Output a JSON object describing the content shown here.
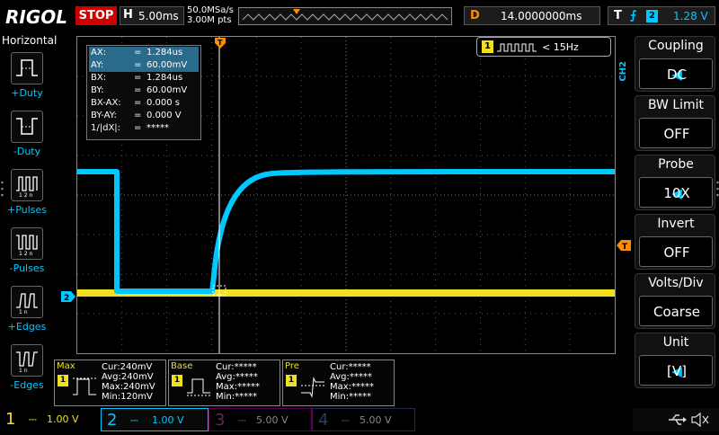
{
  "header": {
    "brand": "RIGOL",
    "run_state": "STOP",
    "timebase_key": "H",
    "timebase": "5.00ms",
    "sample_rate": "50.0MSa/s",
    "memory_depth": "3.00M pts",
    "delay_key": "D",
    "delay": "14.0000000ms",
    "trigger_key": "T",
    "trigger_source": "2",
    "trigger_level": "1.28 V"
  },
  "left_menu": {
    "title": "Horizontal",
    "items": [
      {
        "label": "+Duty"
      },
      {
        "label": "-Duty"
      },
      {
        "label": "+Pulses"
      },
      {
        "label": "-Pulses"
      },
      {
        "label": "+Edges"
      },
      {
        "label": "-Edges"
      }
    ]
  },
  "cursor": {
    "rows": [
      {
        "name": "AX:",
        "eq": "=",
        "value": "1.284us"
      },
      {
        "name": "AY:",
        "eq": "=",
        "value": "60.00mV"
      },
      {
        "name": "BX:",
        "eq": "=",
        "value": "1.284us"
      },
      {
        "name": "BY:",
        "eq": "=",
        "value": "60.00mV"
      },
      {
        "name": "BX-AX:",
        "eq": "=",
        "value": "0.000 s"
      },
      {
        "name": "BY-AY:",
        "eq": "=",
        "value": "0.000 V"
      },
      {
        "name": "1/|dX|:",
        "eq": "=",
        "value": "*****"
      }
    ]
  },
  "frequency": {
    "channel": "1",
    "value": "< 15Hz"
  },
  "side_label": "CH2",
  "right_menu": {
    "items": [
      {
        "title": "Coupling",
        "value": "DC"
      },
      {
        "title": "BW Limit",
        "value": "OFF"
      },
      {
        "title": "Probe",
        "value": "10X"
      },
      {
        "title": "Invert",
        "value": "OFF"
      },
      {
        "title": "Volts/Div",
        "value": "Coarse"
      },
      {
        "title": "Unit",
        "value": "[V]"
      }
    ]
  },
  "measurements": [
    {
      "title": "Max",
      "channel": "1",
      "cur": "Cur:240mV",
      "avg": "Avg:240mV",
      "max": "Max:240mV",
      "min": "Min:120mV"
    },
    {
      "title": "Base",
      "channel": "1",
      "cur": "Cur:*****",
      "avg": "Avg:*****",
      "max": "Max:*****",
      "min": "Min:*****"
    },
    {
      "title": "Pre",
      "channel": "1",
      "cur": "Cur:*****",
      "avg": "Avg:*****",
      "max": "Max:*****",
      "min": "Min:*****"
    }
  ],
  "channels": [
    {
      "num": "1",
      "scale": "1.00 V",
      "color": "#f0e020"
    },
    {
      "num": "2",
      "scale": "1.00 V",
      "color": "#00c8ff"
    },
    {
      "num": "3",
      "scale": "5.00 V",
      "color": "#c000c0"
    },
    {
      "num": "4",
      "scale": "5.00 V",
      "color": "#2050ff"
    }
  ],
  "markers": {
    "ch2": "2",
    "trig": "T"
  },
  "colors": {
    "ch1": "#f0e020",
    "ch2": "#00c8ff",
    "trigger": "#ff8c00",
    "stop": "#d00000"
  }
}
